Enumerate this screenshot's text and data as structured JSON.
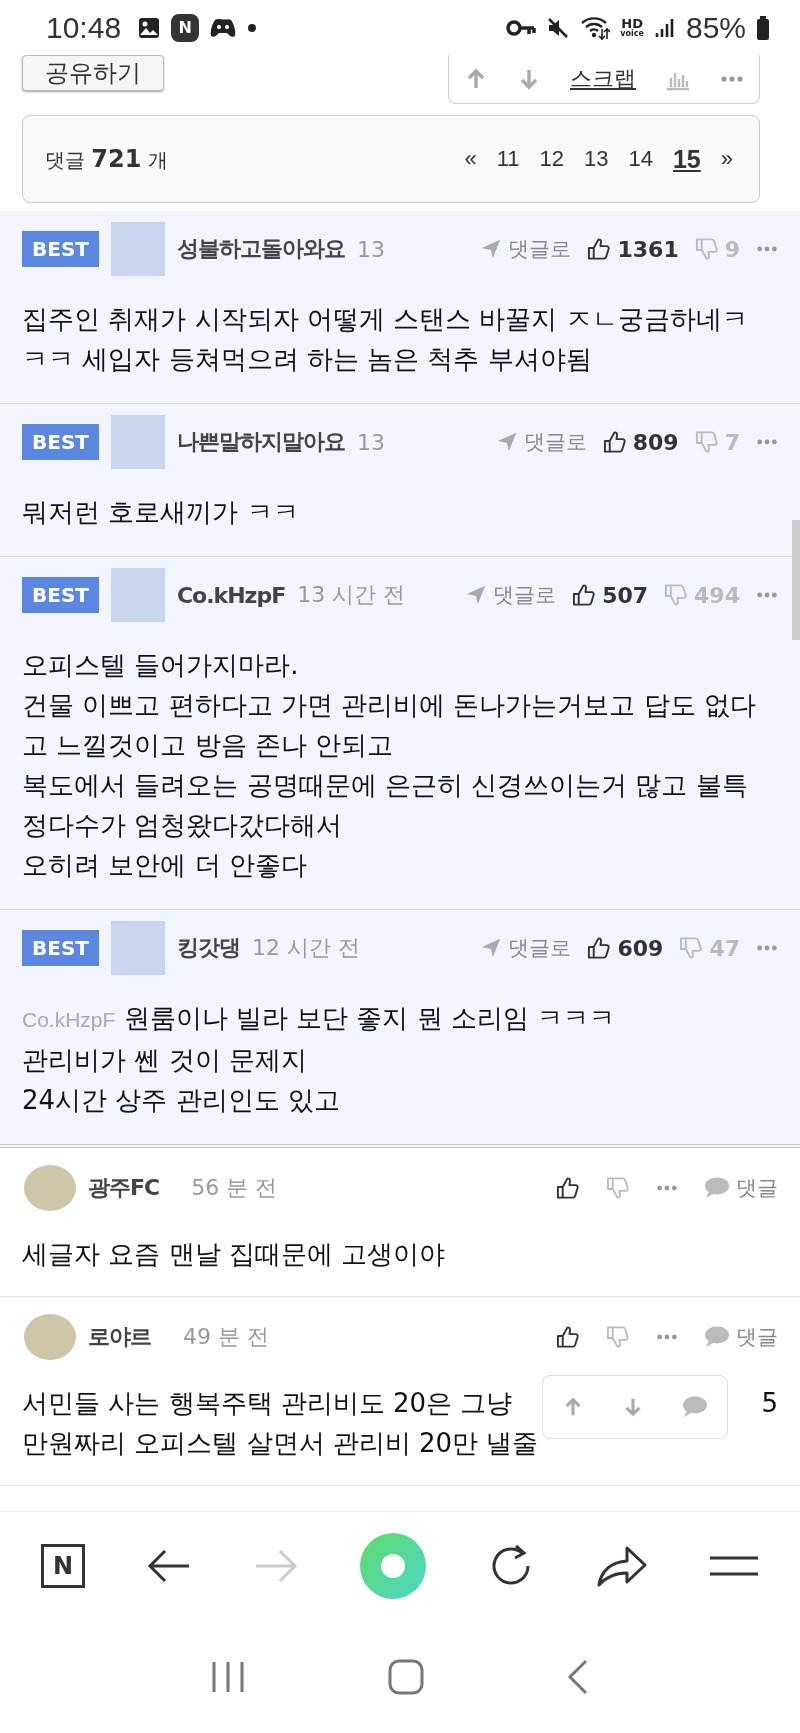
{
  "status_bar": {
    "time": "10:48",
    "n_badge": "N",
    "hd_voice": [
      "HD",
      "voice"
    ],
    "battery": "85%"
  },
  "top_actions": {
    "share_button": "공유하기",
    "scrap_link": "스크랩"
  },
  "comment_count": {
    "label": "댓글",
    "count": "721",
    "unit": "개",
    "pages": [
      {
        "label": "«",
        "selected": false
      },
      {
        "label": "11",
        "selected": false
      },
      {
        "label": "12",
        "selected": false
      },
      {
        "label": "13",
        "selected": false
      },
      {
        "label": "14",
        "selected": false
      },
      {
        "label": "15",
        "selected": true
      },
      {
        "label": "»",
        "selected": false
      }
    ]
  },
  "best_comments": [
    {
      "badge": "BEST",
      "author": "성불하고돌아와요",
      "time": "13",
      "reply": "댓글로",
      "likes": "1361",
      "dislikes": "9",
      "lines": [
        "집주인 취재가 시작되자 어떻게 스탠스 바꿀지 ㅈㄴ궁금하네ㅋ",
        "ㅋㅋ 세입자 등쳐먹으려 하는 놈은 척추 부셔야됨"
      ]
    },
    {
      "badge": "BEST",
      "author": "나쁜말하지말아요",
      "time": "13",
      "reply": "댓글로",
      "likes": "809",
      "dislikes": "7",
      "lines": [
        "뭐저런 호로새끼가 ㅋㅋ"
      ]
    },
    {
      "badge": "BEST",
      "author": "Co.kHzpF",
      "time": "13 시간 전",
      "reply": "댓글로",
      "likes": "507",
      "dislikes": "494",
      "lines": [
        "오피스텔 들어가지마라.",
        "건물 이쁘고 편하다고 가면 관리비에 돈나가는거보고 답도 없다",
        "고 느낄것이고 방음 존나 안되고",
        "복도에서 들려오는 공명때문에 은근히 신경쓰이는거 많고 불특",
        "정다수가 엄청왔다갔다해서",
        "오히려 보안에 더 안좋다"
      ]
    },
    {
      "badge": "BEST",
      "author": "킹갓댕",
      "time": "12 시간 전",
      "reply": "댓글로",
      "likes": "609",
      "dislikes": "47",
      "mention": "Co.kHzpF",
      "lines": [
        "원룸이나 빌라 보단 좋지 뭔 소리임 ㅋㅋㅋ",
        "관리비가 쎈 것이 문제지",
        "24시간 상주 관리인도 있고"
      ]
    }
  ],
  "comments": [
    {
      "author": "광주FC",
      "time": "56 분 전",
      "reply": "댓글",
      "lines": [
        {
          "text": "세글자 요즘 맨날 집때문에 고생이야"
        }
      ]
    },
    {
      "author": "로야르",
      "time": "49 분 전",
      "reply": "댓글",
      "lines": [
        {
          "text": "서민들 사는 행복주택 관리비도 20은 그냥",
          "tail": "5"
        },
        {
          "text": "만원짜리 오피스텔 살면서 관리비 20만 낼줄"
        }
      ]
    }
  ],
  "browser_toolbar": {
    "logo": "N",
    "forward_disabled": true
  }
}
